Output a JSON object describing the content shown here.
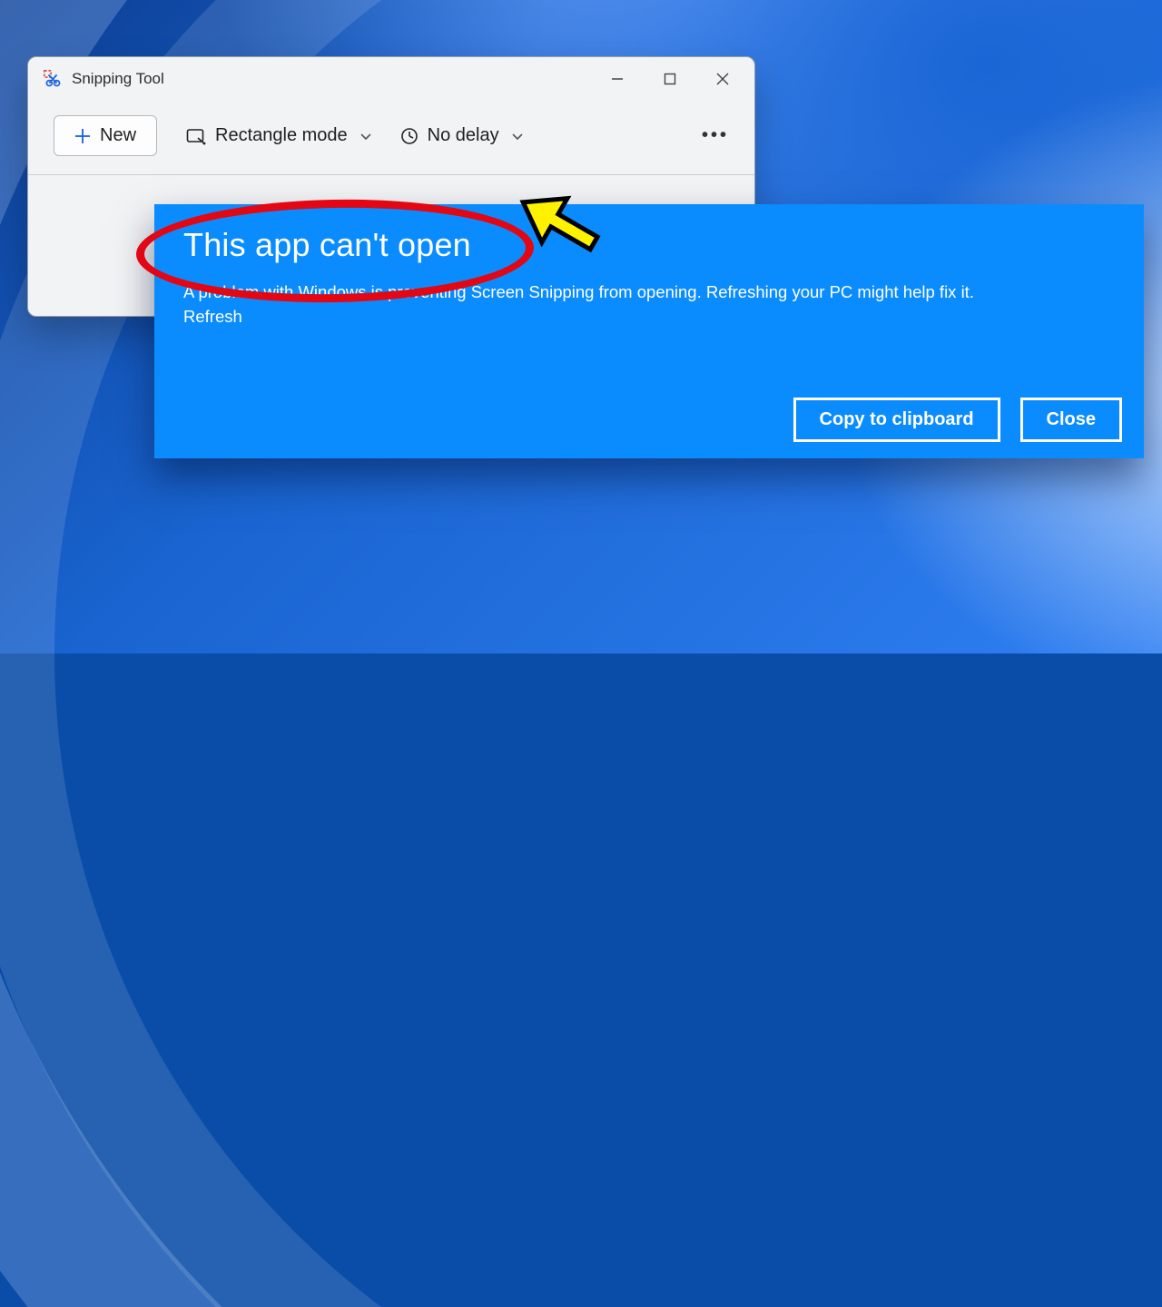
{
  "snipping": {
    "title": "Snipping Tool",
    "new_label": "New",
    "mode_label": "Rectangle mode",
    "delay_label": "No delay",
    "more_label": "•••"
  },
  "error": {
    "title": "This app can't open",
    "body_line1": "A problem with Windows is preventing Screen Snipping from opening. Refreshing your PC might help fix it.",
    "body_line2": "Refresh",
    "copy_label": "Copy to clipboard",
    "close_label": "Close"
  }
}
